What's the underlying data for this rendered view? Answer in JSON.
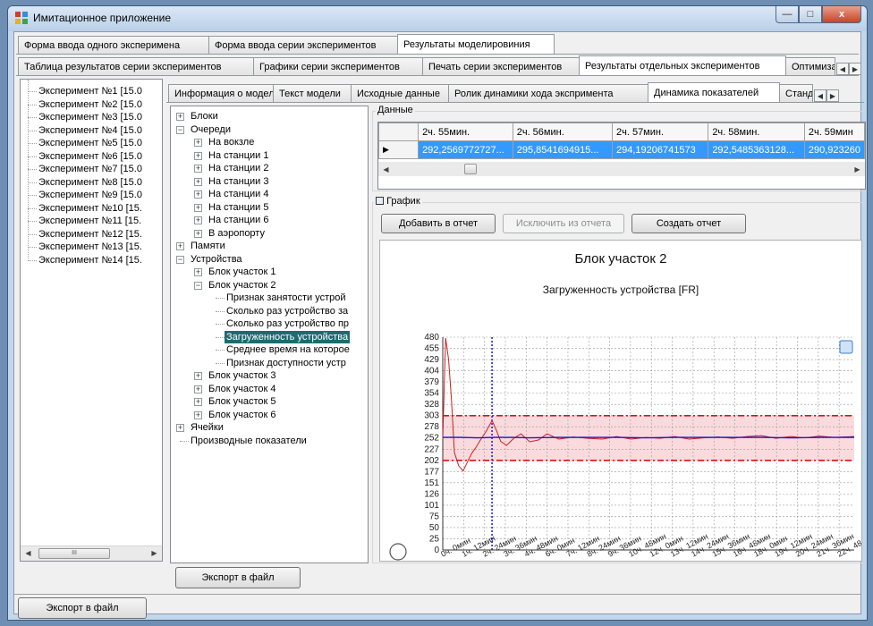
{
  "window": {
    "title": "Имитационное приложение",
    "buttons": {
      "minimize": "—",
      "maximize": "□",
      "close": "x"
    }
  },
  "top_tabs": [
    "Форма ввода одного эксперимена",
    "Форма ввода серии экспериментов",
    "Результаты моделировиния"
  ],
  "sub_tabs": [
    "Таблица результатов серии экспериментов",
    "Графики серии экспериментов",
    "Печать серии экспериментов",
    "Результаты отдельных экспериментов",
    "Оптимиза"
  ],
  "experiments": [
    "Эксперимент №1 [15.0",
    "Эксперимент №2 [15.0",
    "Эксперимент №3 [15.0",
    "Эксперимент №4 [15.0",
    "Эксперимент №5 [15.0",
    "Эксперимент №6 [15.0",
    "Эксперимент №7 [15.0",
    "Эксперимент №8 [15.0",
    "Эксперимент №9 [15.0",
    "Эксперимент №10 [15.",
    "Эксперимент №11 [15.",
    "Эксперимент №12 [15.",
    "Эксперимент №13 [15.",
    "Эксперимент №14 [15."
  ],
  "left_scroll_thumb": "III",
  "inner_tabs": [
    "Информация о модели:",
    "Текст модели",
    "Исходные данные",
    "Ролик динамики хода экспримента",
    "Динамика показателей",
    "Станд"
  ],
  "tree": {
    "blocks": "Блоки",
    "queues": "Очереди",
    "queue_items": [
      "На вокзле",
      "На станции 1",
      "На станции 2",
      "На станции 3",
      "На станции 4",
      "На станции 5",
      "На станции 6",
      "В аэропорту"
    ],
    "memory": "Памяти",
    "devices": "Устройства",
    "block1": "Блок участок 1",
    "block2": "Блок участок 2",
    "block2_items": [
      "Признак занятости устрой",
      "Сколько раз устройство за",
      "Сколько раз устройство пр",
      "Загруженность устройства",
      "Среднее время на которое",
      "Признак доступности устр"
    ],
    "blocks_rest": [
      "Блок участок 3",
      "Блок участок 4",
      "Блок участок 5",
      "Блок участок 6"
    ],
    "cells": "Ячейки",
    "derived": "Производные показатели"
  },
  "data_group": {
    "label": "Данные",
    "headers": [
      "2ч. 55мин.",
      "2ч. 56мин.",
      "2ч. 57мин.",
      "2ч. 58мин.",
      "2ч. 59мин"
    ],
    "values": [
      "292,2569772727...",
      "295,8541694915...",
      "294,19206741573",
      "292,5485363128...",
      "290,923260"
    ]
  },
  "graph_group": {
    "label": "График",
    "add_button": "Добавить в отчет",
    "remove_button": "Исключить из отчета",
    "create_button": "Создать отчет"
  },
  "export_inner": "Экспорт в файл",
  "export_outer": "Экспорт в файл",
  "colors": {
    "series": "#cc2020",
    "trend": "#1a1ad0",
    "band": "#fadadd",
    "limit": "#e01010",
    "selection": "#1f6a70"
  },
  "chart_data": {
    "type": "line",
    "title": "Блок участок 2",
    "subtitle": "Загруженность устройства [FR]",
    "ylim": [
      0,
      480
    ],
    "y_ticks": [
      "0",
      "25",
      "50",
      "75",
      "101",
      "126",
      "151",
      "177",
      "202",
      "227",
      "252",
      "278",
      "303",
      "328",
      "354",
      "379",
      "404",
      "429",
      "455",
      "480"
    ],
    "x_ticks": [
      "0ч. 0мин",
      "1ч. 12мин",
      "2ч. 24мин",
      "3ч. 36мин",
      "4ч. 48мин",
      "6ч. 0мин",
      "7ч. 12мин",
      "8ч. 24мин",
      "9ч. 36мин",
      "10ч. 48мин",
      "12ч. 0мин",
      "13ч. 12мин",
      "14ч. 24мин",
      "15ч. 36мин",
      "16ч. 48мин",
      "18ч. 0мин",
      "19ч. 12мин",
      "20ч. 24мин",
      "21ч. 36мин",
      "22ч. 48"
    ],
    "xlim_minutes": [
      0,
      1420
    ],
    "upper_limit": 303,
    "lower_limit": 202,
    "mean": 254,
    "marker_x_minutes": 170,
    "series": [
      {
        "x": [
          0,
          10,
          20,
          30,
          40,
          55,
          70,
          85,
          100,
          115,
          130,
          150,
          170,
          185,
          200,
          220,
          245,
          270,
          300,
          330,
          360,
          400,
          450,
          500,
          550,
          600,
          650,
          700,
          750,
          800,
          850,
          900,
          950,
          1000,
          1050,
          1100,
          1150,
          1200,
          1250,
          1300,
          1350,
          1420
        ],
        "values": [
          250,
          478,
          430,
          340,
          220,
          190,
          178,
          198,
          218,
          232,
          248,
          268,
          292,
          270,
          245,
          236,
          252,
          262,
          244,
          248,
          262,
          250,
          255,
          252,
          250,
          256,
          250,
          254,
          252,
          256,
          250,
          253,
          255,
          252,
          256,
          258,
          252,
          256,
          253,
          257,
          254,
          256
        ]
      },
      {
        "x": [
          0,
          60,
          120,
          180,
          240,
          300,
          400,
          500,
          600,
          700,
          800,
          900,
          1000,
          1100,
          1200,
          1300,
          1420
        ],
        "values": [
          254,
          254,
          253,
          254,
          254,
          253,
          254,
          254,
          254,
          253,
          254,
          254,
          254,
          254,
          253,
          254,
          254
        ]
      }
    ]
  }
}
